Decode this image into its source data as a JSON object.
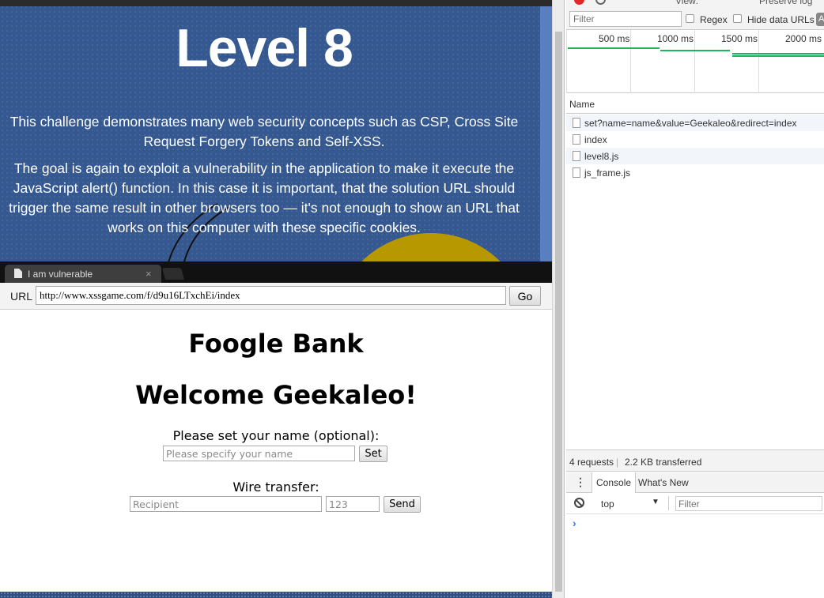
{
  "game_page": {
    "title": "Level 8",
    "paragraph1": "This challenge demonstrates many web security concepts such as CSP, Cross Site Request Forgery Tokens and Self-XSS.",
    "paragraph2": "The goal is again to exploit a vulnerability in the application to make it execute the JavaScript alert() function. In this case it is important, that the solution URL should trigger the same result in other browsers too — it's not enough to show an URL that works on this computer with these specific cookies."
  },
  "inner_browser": {
    "tab_title": "I am vulnerable",
    "tab_close": "×",
    "url_label": "URL",
    "url_value": "http://www.xssgame.com/f/d9u16LTxchEi/index",
    "go_label": "Go"
  },
  "bank": {
    "title": "Foogle Bank",
    "welcome": "Welcome Geekaleo!",
    "name_label": "Please set your name (optional):",
    "name_placeholder": "Please specify your name",
    "set_label": "Set",
    "wire_label": "Wire transfer:",
    "recipient_placeholder": "Recipient",
    "amount_placeholder": "123",
    "send_label": "Send"
  },
  "devtools": {
    "toolbar": {
      "view_label": "View:",
      "preserve_label": "Preserve log"
    },
    "filter_placeholder": "Filter",
    "regex_label": "Regex",
    "hide_data_urls_label": "Hide data URLs",
    "all_label": "A",
    "timeline": [
      "500 ms",
      "1000 ms",
      "1500 ms",
      "2000 ms"
    ],
    "name_header": "Name",
    "requests": [
      "set?name=name&value=Geekaleo&redirect=index",
      "index",
      "level8.js",
      "js_frame.js"
    ],
    "summary": {
      "requests": "4 requests",
      "separator": "|",
      "transferred": "2.2 KB transferred"
    },
    "console_tabs": {
      "console": "Console",
      "whats_new": "What's New"
    },
    "context": "top",
    "context_caret": "▼",
    "console_filter_placeholder": "Filter",
    "prompt": "›",
    "colors": {
      "record": "#e02a2a",
      "waterfall": "#1fb35a",
      "prompt": "#367cf1"
    }
  }
}
